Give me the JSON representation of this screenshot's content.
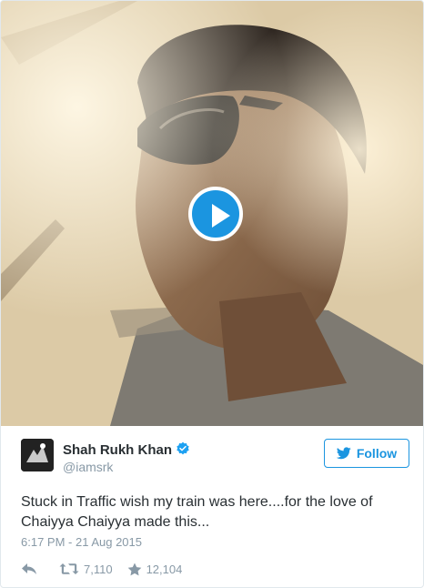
{
  "media": {
    "type": "video",
    "play_icon": "play-icon"
  },
  "author": {
    "name": "Shah Rukh Khan",
    "handle": "@iamsrk",
    "verified": true,
    "verified_icon": "verified-badge-icon"
  },
  "follow_button": {
    "label": "Follow",
    "icon": "twitter-bird-icon"
  },
  "tweet": {
    "text": "Stuck in Traffic wish my train was here....for the love of Chaiyya Chaiyya made this...",
    "timestamp": "6:17 PM - 21 Aug 2015"
  },
  "actions": {
    "reply_icon": "reply-icon",
    "retweet_icon": "retweet-icon",
    "retweet_count": "7,110",
    "like_icon": "star-icon",
    "like_count": "12,104"
  },
  "colors": {
    "accent": "#1b95e0",
    "text": "#292f33",
    "muted": "#8899a6"
  }
}
